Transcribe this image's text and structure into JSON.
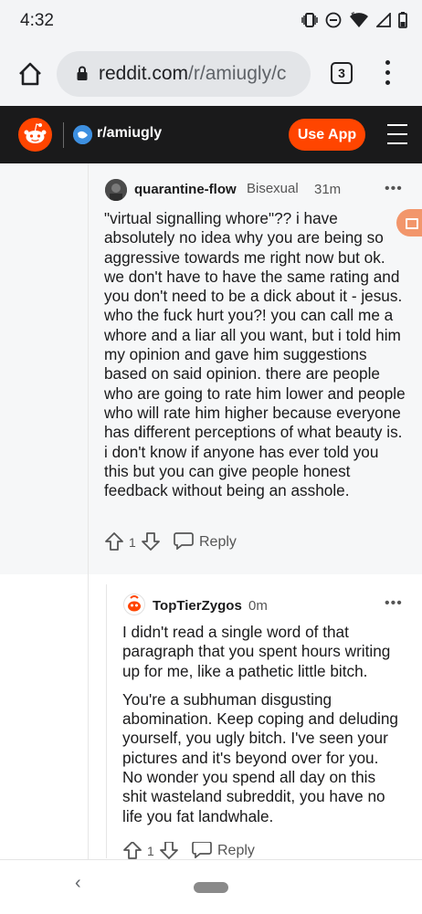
{
  "status_bar": {
    "time": "4:32"
  },
  "browser": {
    "url_domain": "reddit.com",
    "url_path": "/r/amiugly/c",
    "tab_count": "3"
  },
  "reddit_header": {
    "subreddit": "r/amiugly",
    "use_app_label": "Use App"
  },
  "comments": [
    {
      "username": "quarantine-flow",
      "flair": "Bisexual",
      "time": "31m",
      "body": "\"virtual signalling whore\"?? i have absolutely no idea why you are being so aggressive towards me right now but ok. we don't have to have the same rating and you don't need to be a dick about it - jesus. who the fuck hurt you?! you can call me a whore and a liar all you want, but i told him my opinion and gave him suggestions based on said opinion. there are people who are going to rate him lower and people who will rate him higher because everyone has different perceptions of what beauty is. i don't know if anyone has ever told you this but you can give people honest feedback without being an asshole.",
      "score": "1",
      "reply_label": "Reply"
    },
    {
      "username": "TopTierZygos",
      "time": "0m",
      "paragraphs": [
        "I didn't read a single word of that paragraph that you spent hours writing up for me, like a pathetic little bitch.",
        "You're a subhuman disgusting abomination. Keep coping and deluding yourself, you ugly bitch. I've seen your pictures and it's beyond over for you. No wonder you spend all day on this shit wasteland subreddit, you have no life you fat landwhale."
      ],
      "score": "1",
      "reply_label": "Reply"
    }
  ],
  "colors": {
    "brand": "#ff4500",
    "header_bg": "#1a1a1b"
  }
}
